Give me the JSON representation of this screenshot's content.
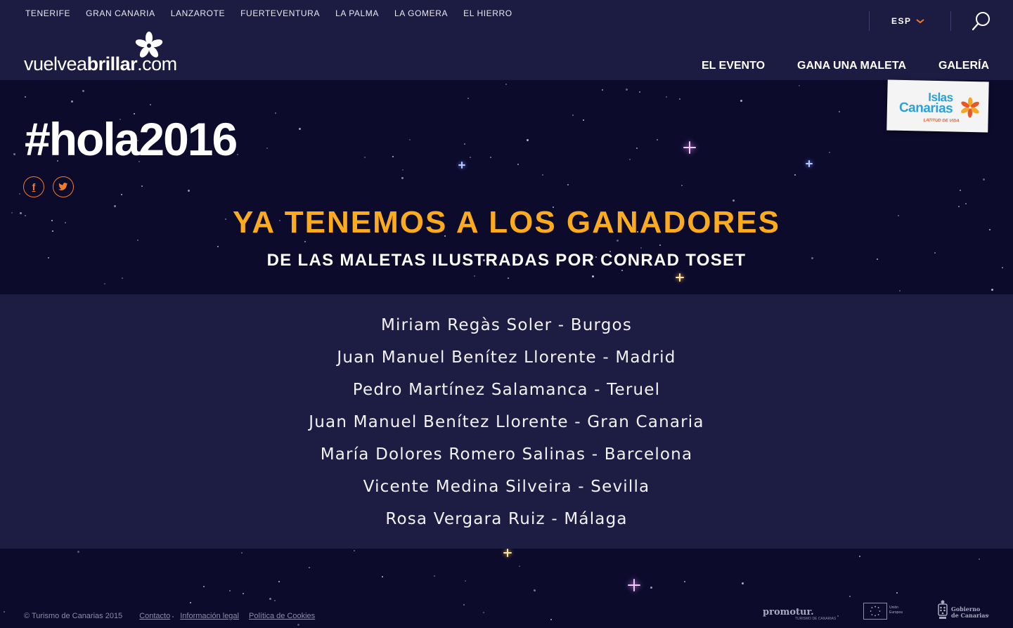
{
  "island_nav": [
    "TENERIFE",
    "GRAN CANARIA",
    "LANZAROTE",
    "FUERTEVENTURA",
    "LA PALMA",
    "LA GOMERA",
    "EL HIERRO"
  ],
  "logo": {
    "part1": "vuelve",
    "part2": "a",
    "part3": "brillar",
    "part4": ".com",
    "icon": "flower-logo-icon"
  },
  "language": {
    "label": "ESP",
    "icon": "chevron-down-icon"
  },
  "search": {
    "icon": "search-icon"
  },
  "main_nav": [
    "EL EVENTO",
    "GANA UNA MALETA",
    "GALERÍA"
  ],
  "badge": {
    "line1": "Islas",
    "line2": "Canarias",
    "tagline": "LATITUD DE VIDA",
    "icon": "flower-icon"
  },
  "hero": {
    "title": "#hola2016",
    "social": [
      {
        "name": "facebook-icon",
        "glyph": "f"
      },
      {
        "name": "twitter-icon",
        "glyph": "t"
      }
    ],
    "headline": "YA TENEMOS A LOS GANADORES",
    "subheadline": "DE LAS MALETAS ILUSTRADAS POR CONRAD TOSET"
  },
  "winners": [
    "Miriam Regàs Soler - Burgos",
    "Juan Manuel Benítez Llorente - Madrid",
    "Pedro Martínez Salamanca - Teruel",
    "Juan Manuel Benítez Llorente - Gran Canaria",
    "María Dolores Romero Salinas - Barcelona",
    "Vicente Medina Silveira - Sevilla",
    "Rosa Vergara Ruiz - Málaga"
  ],
  "footer": {
    "copyright": "© Turismo de Canarias 2015",
    "links": [
      "Contacto",
      "Información legal",
      "Política de Cookies"
    ],
    "partners": {
      "promotur": "promotur.",
      "promotur_sub": "TURISMO DE CANARIAS",
      "eu_text": "Unión Europea",
      "gobierno_line1": "Gobierno",
      "gobierno_line2": "de Canarias"
    }
  },
  "colors": {
    "background": "#0c0b2c",
    "header": "#1c1c42",
    "accent_orange": "#fbab1c",
    "social_orange": "#f27b2e",
    "badge_blue": "#2aa2d8"
  }
}
